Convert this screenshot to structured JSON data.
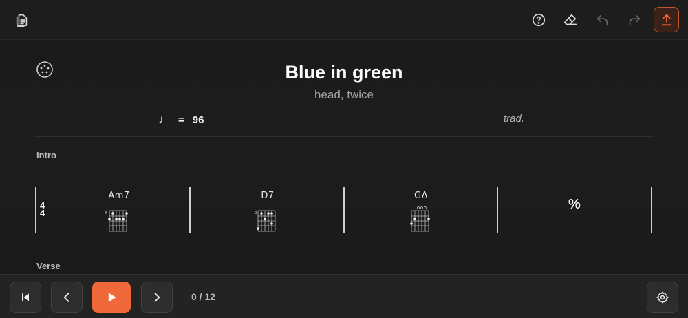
{
  "toolbar": {
    "icons": [
      "document-icon",
      "help-icon",
      "eraser-icon",
      "undo-icon",
      "redo-icon",
      "export-icon"
    ],
    "accent": "#f0693a"
  },
  "sheet": {
    "title": "Blue in green",
    "subtitle": "head, twice",
    "tempo_note": "♩",
    "tempo_eq": "=",
    "tempo_value": "96",
    "composer": "trad."
  },
  "sections": [
    {
      "label": "Intro",
      "time_signature": {
        "top": "4",
        "bottom": "4"
      },
      "measures": [
        {
          "chord": "Am7",
          "fret_label": "5"
        },
        {
          "chord": "D7",
          "fret_label": "10"
        },
        {
          "chord": "GΔ",
          "fret_label": ""
        },
        {
          "chord": "",
          "repeat_symbol": "%"
        }
      ]
    },
    {
      "label": "Verse"
    }
  ],
  "playback": {
    "position": "0 / 12"
  }
}
